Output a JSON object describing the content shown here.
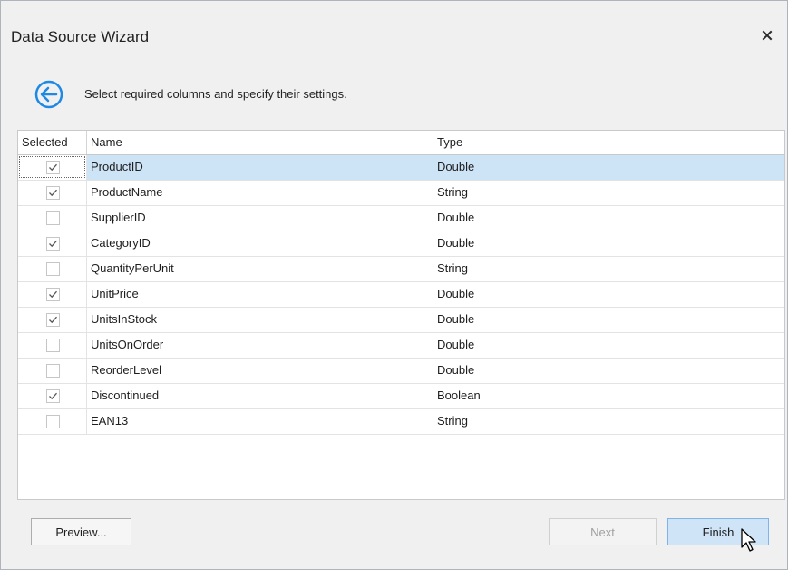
{
  "window": {
    "title": "Data Source Wizard"
  },
  "header": {
    "instructions": "Select required columns and specify their settings."
  },
  "grid": {
    "columns": [
      "Selected",
      "Name",
      "Type"
    ],
    "rows": [
      {
        "selected": true,
        "name": "ProductID",
        "type": "Double"
      },
      {
        "selected": true,
        "name": "ProductName",
        "type": "String"
      },
      {
        "selected": false,
        "name": "SupplierID",
        "type": "Double"
      },
      {
        "selected": true,
        "name": "CategoryID",
        "type": "Double"
      },
      {
        "selected": false,
        "name": "QuantityPerUnit",
        "type": "String"
      },
      {
        "selected": true,
        "name": "UnitPrice",
        "type": "Double"
      },
      {
        "selected": true,
        "name": "UnitsInStock",
        "type": "Double"
      },
      {
        "selected": false,
        "name": "UnitsOnOrder",
        "type": "Double"
      },
      {
        "selected": false,
        "name": "ReorderLevel",
        "type": "Double"
      },
      {
        "selected": true,
        "name": "Discontinued",
        "type": "Boolean"
      },
      {
        "selected": false,
        "name": "EAN13",
        "type": "String"
      }
    ],
    "focused_row": 0
  },
  "footer": {
    "preview_label": "Preview...",
    "next_label": "Next",
    "finish_label": "Finish",
    "next_enabled": false
  },
  "colors": {
    "accent": "#1e88e5",
    "selected_row": "#cde3f6",
    "finish_button": "#cfe4f7"
  },
  "icons": {
    "close": "close-icon",
    "back": "back-arrow-icon",
    "check": "check-icon",
    "cursor": "mouse-pointer-icon"
  }
}
